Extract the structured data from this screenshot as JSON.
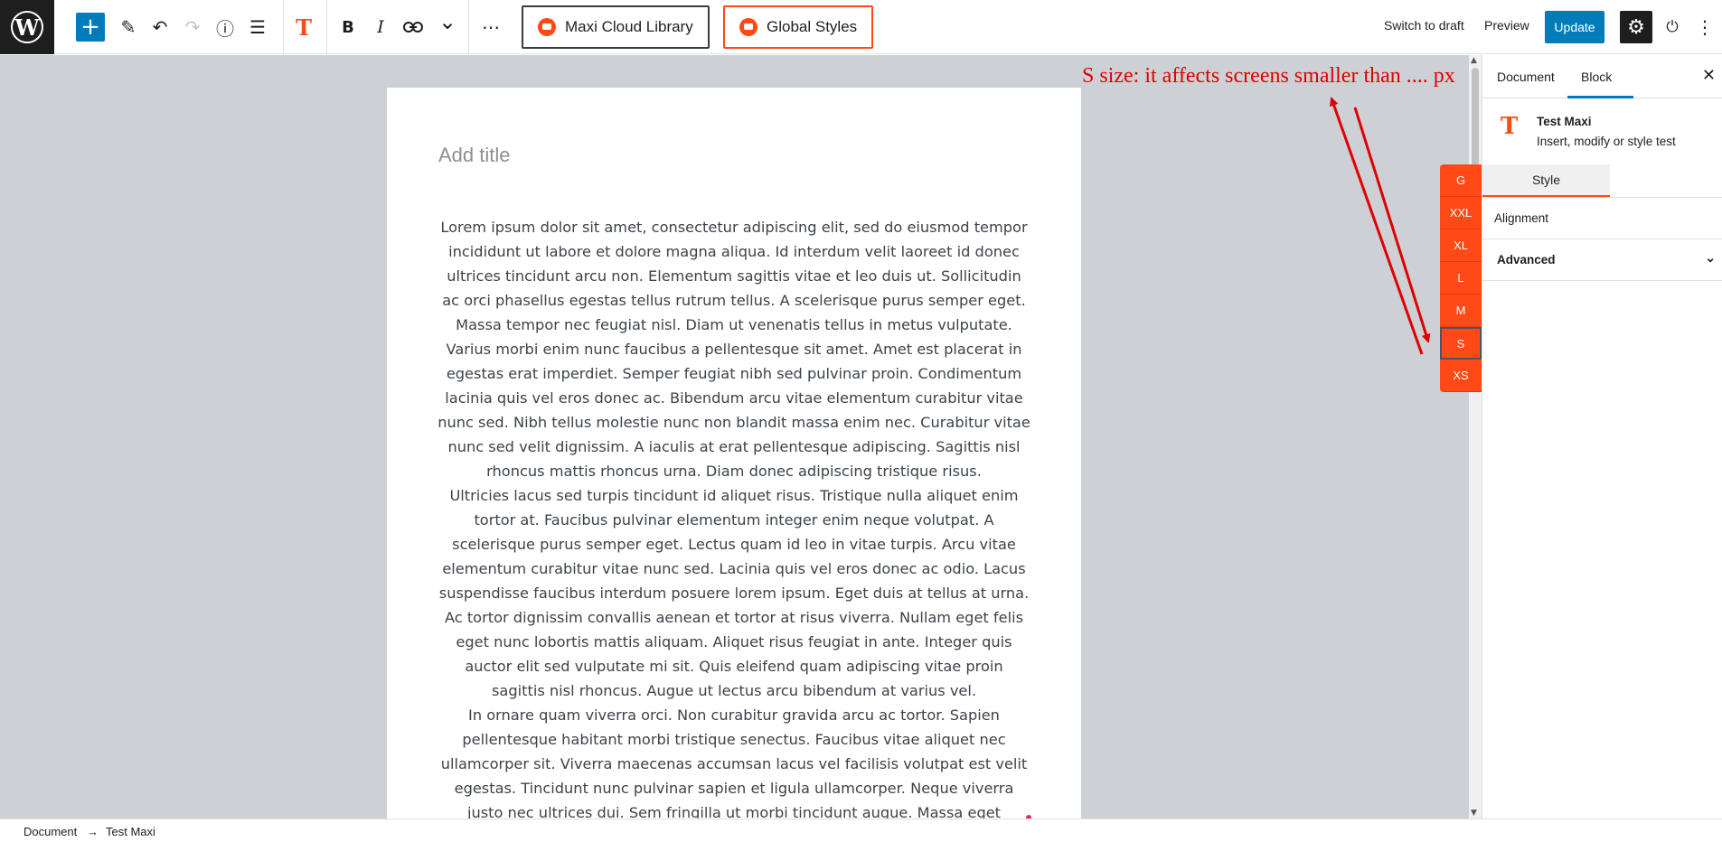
{
  "toolbar": {
    "logo_glyph": "W",
    "add_glyph": "+",
    "edit_glyph": "✎",
    "undo_glyph": "↶",
    "redo_glyph": "↷",
    "info_glyph": "ⓘ",
    "list_glyph": "☰",
    "maxi_glyph": "T",
    "bold_glyph": "B",
    "italic_glyph": "I",
    "link_glyph": "🔗",
    "more_format_glyph": "⌄",
    "options_glyph": "⋯",
    "cloud_library_label": "Maxi Cloud Library",
    "global_styles_label": "Global Styles",
    "switch_to_draft_label": "Switch to draft",
    "preview_label": "Preview",
    "update_label": "Update",
    "settings_glyph": "⚙",
    "plugin_glyph": "⏻",
    "kebab_glyph": "⋮"
  },
  "editor": {
    "title_placeholder": "Add title",
    "paragraphs": [
      "Lorem ipsum dolor sit amet, consectetur adipiscing elit, sed do eiusmod tempor incididunt ut labore et dolore magna aliqua. Id interdum velit laoreet id donec ultrices tincidunt arcu non. Elementum sagittis vitae et leo duis ut. Sollicitudin ac orci phasellus egestas tellus rutrum tellus. A scelerisque purus semper eget. Massa tempor nec feugiat nisl. Diam ut venenatis tellus in metus vulputate. Varius morbi enim nunc faucibus a pellentesque sit amet. Amet est placerat in egestas erat imperdiet. Semper feugiat nibh sed pulvinar proin. Condimentum lacinia quis vel eros donec ac. Bibendum arcu vitae elementum curabitur vitae nunc sed. Nibh tellus molestie nunc non blandit massa enim nec. Curabitur vitae nunc sed velit dignissim. A iaculis at erat pellentesque adipiscing. Sagittis nisl rhoncus mattis rhoncus urna. Diam donec adipiscing tristique risus.",
      "Ultricies lacus sed turpis tincidunt id aliquet risus. Tristique nulla aliquet enim tortor at. Faucibus pulvinar elementum integer enim neque volutpat. A scelerisque purus semper eget. Lectus quam id leo in vitae turpis. Arcu vitae elementum curabitur vitae nunc sed. Lacinia quis vel eros donec ac odio. Lacus suspendisse faucibus interdum posuere lorem ipsum. Eget duis at tellus at urna. Ac tortor dignissim convallis aenean et tortor at risus viverra. Nullam eget felis eget nunc lobortis mattis aliquam. Aliquet risus feugiat in ante. Integer quis auctor elit sed vulputate mi sit. Quis eleifend quam adipiscing vitae proin sagittis nisl rhoncus. Augue ut lectus arcu bibendum at varius vel.",
      "In ornare quam viverra orci. Non curabitur gravida arcu ac tortor. Sapien pellentesque habitant morbi tristique senectus. Faucibus vitae aliquet nec ullamcorper sit. Viverra maecenas accumsan lacus vel facilisis volutpat est velit egestas. Tincidunt nunc pulvinar sapien et ligula ullamcorper. Neque viverra justo nec ultrices dui. Sem fringilla ut morbi tincidunt augue. Massa eget egestas purus viverra accumsan in nisl nisi scelerisque. Vel eros donec ac odio tempor orci. Mi ipsum faucibus vitae aliquet nec ullamcorper sit"
    ]
  },
  "annotation": {
    "text": "S size: it affects screens smaller than .... px",
    "color": "#e00000"
  },
  "breakpoints": {
    "items": [
      "G",
      "XXL",
      "XL",
      "L",
      "M",
      "S",
      "XS"
    ],
    "active": "S",
    "color": "#ff4a17"
  },
  "sidebar": {
    "tab_document": "Document",
    "tab_block": "Block",
    "close_glyph": "✕",
    "block_icon_glyph": "T",
    "block_name": "Test Maxi",
    "block_description": "Insert, modify or style test",
    "style_tab": "Style",
    "alignment_label": "Alignment",
    "advanced_label": "Advanced",
    "chevron_glyph": "⌄"
  },
  "scrollbar": {
    "up_glyph": "▲",
    "down_glyph": "▼"
  },
  "footer": {
    "crumb_document": "Document",
    "crumb_separator": "→",
    "crumb_block": "Test Maxi"
  },
  "colors": {
    "accent": "#007cba",
    "maxi_orange": "#ff4a17",
    "canvas_bg": "#cdd1d5"
  }
}
